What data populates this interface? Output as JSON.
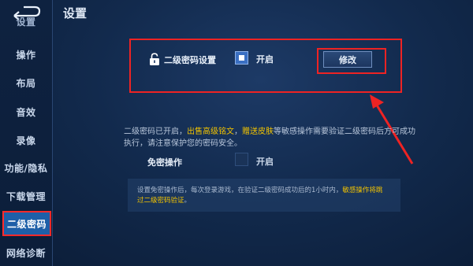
{
  "header": {
    "title": "设置"
  },
  "sidebar": {
    "items": [
      {
        "label": "设置",
        "state": "partial"
      },
      {
        "label": "操作"
      },
      {
        "label": "布局"
      },
      {
        "label": "音效"
      },
      {
        "label": "录像"
      },
      {
        "label": "功能/隐私"
      },
      {
        "label": "下载管理"
      },
      {
        "label": "二级密码",
        "state": "active"
      },
      {
        "label": "网络诊断"
      }
    ]
  },
  "password": {
    "label": "二级密码设置",
    "checked": true,
    "toggle_label": "开启",
    "modify_label": "修改"
  },
  "description": {
    "part1": "二级密码已开启，",
    "hl1": "出售高级铭文",
    "part2": "，",
    "hl2": "赠送皮肤",
    "part3": "等敏感操作需要验证二级密码后方可成功执行，请注意保护您的密码安全。"
  },
  "no_password": {
    "label": "免密操作",
    "checked": false,
    "toggle_label": "开启"
  },
  "info": {
    "part1": "设置免密操作后，每次登录游戏，在验证二级密码成功后的1小时内，",
    "hl": "敏感操作将跳过二级密码验证",
    "part2": "。"
  },
  "colors": {
    "highlight_border": "#ee2323",
    "accent_text": "#f2c300",
    "active_tab": "#1e5fa8"
  }
}
